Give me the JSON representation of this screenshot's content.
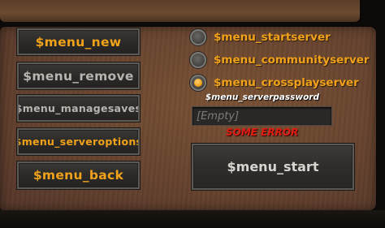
{
  "menu": {
    "new_label": "$menu_new",
    "remove_label": "$menu_remove",
    "managesaves_label": "$menu_managesaves",
    "serveroptions_label": "$menu_serveroptions",
    "back_label": "$menu_back"
  },
  "server_options": {
    "startserver_label": "$menu_startserver",
    "communityserver_label": "$menu_communityserver",
    "crossplayserver_label": "$menu_crossplayserver",
    "selected": "crossplayserver"
  },
  "password": {
    "label": "$menu_serverpassword",
    "value": "",
    "placeholder": "[Empty]"
  },
  "error_text": "SOME ERROR",
  "start_label": "$menu_start",
  "colors": {
    "accent": "#f0a21a",
    "error": "#e11c12",
    "panel_wood": "#6a4630"
  }
}
